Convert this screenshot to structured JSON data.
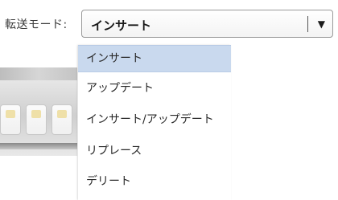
{
  "transfer_mode": {
    "label": "転送モード:",
    "selected_value": "インサート",
    "arrow_icon": "▼",
    "options": [
      {
        "label": "インサート",
        "selected": true
      },
      {
        "label": "アップデート",
        "selected": false
      },
      {
        "label": "インサート/アップデート",
        "selected": false
      },
      {
        "label": "リプレース",
        "selected": false
      },
      {
        "label": "デリート",
        "selected": false
      }
    ]
  },
  "colors": {
    "highlight": "#c9d9ee",
    "border": "#9a9a9a",
    "text": "#2a2a2a"
  }
}
